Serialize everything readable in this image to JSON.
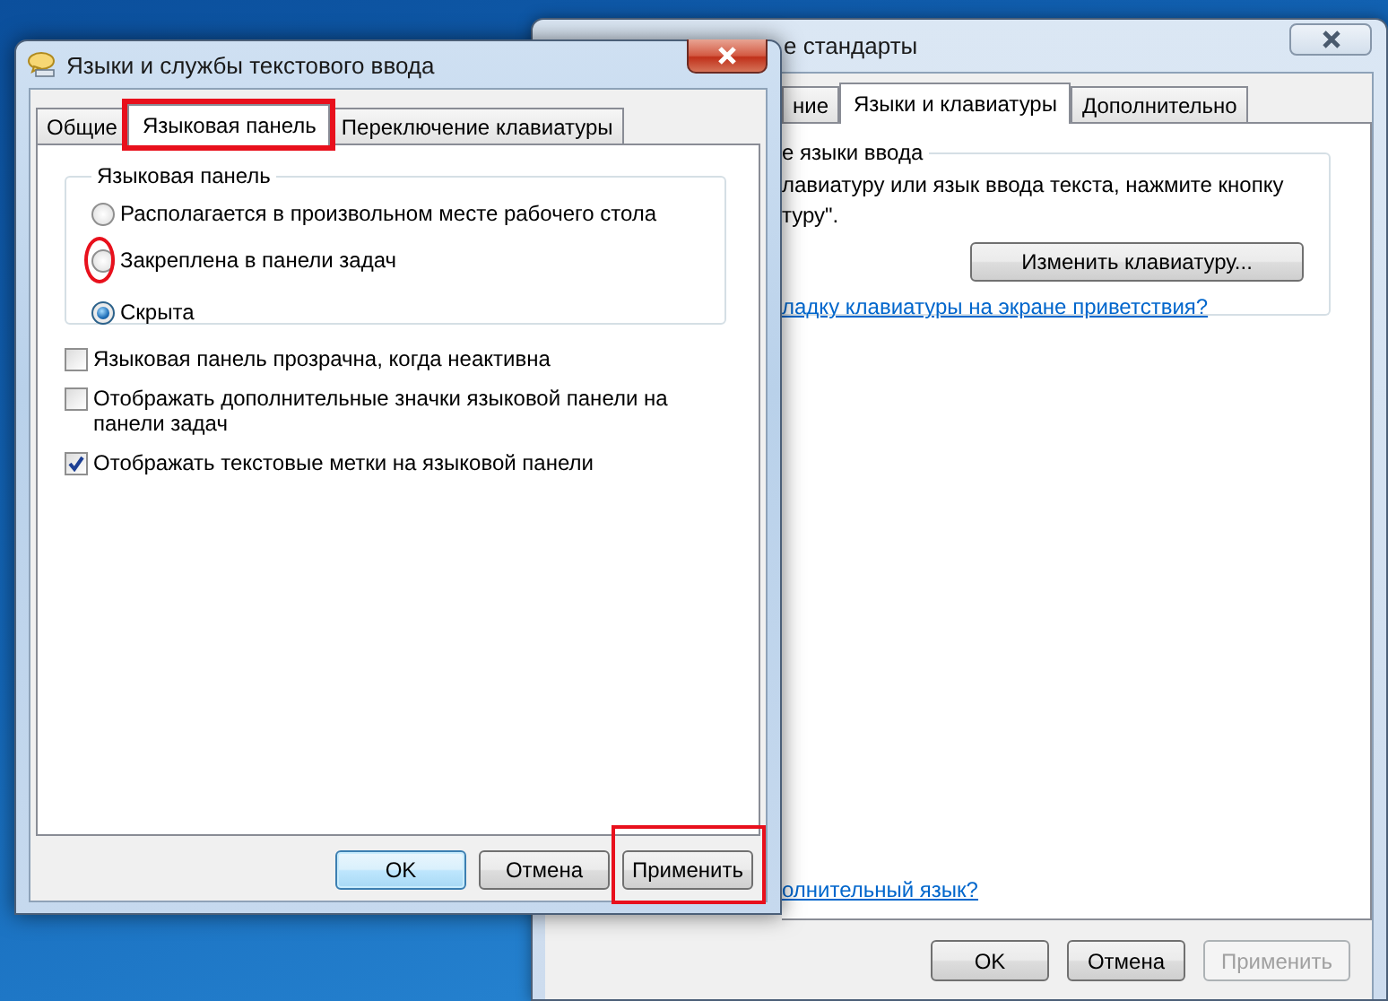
{
  "back_window": {
    "title": "е стандарты",
    "tabs": [
      {
        "label": "ние",
        "selected": false
      },
      {
        "label": "Языки и клавиатуры",
        "selected": true
      },
      {
        "label": "Дополнительно",
        "selected": false
      }
    ],
    "group": {
      "label": "е языки ввода",
      "text_lines": [
        "лавиатуру или язык ввода текста, нажмите кнопку",
        "туру\"."
      ],
      "button": "Изменить клавиатуру...",
      "link": "ладку клавиатуры на экране приветствия?"
    },
    "bottom_link": "олнительный язык?",
    "buttons": [
      {
        "label": "OK",
        "disabled": false
      },
      {
        "label": "Отмена",
        "disabled": false
      },
      {
        "label": "Применить",
        "disabled": true
      }
    ]
  },
  "front_window": {
    "title": "Языки и службы текстового ввода",
    "tabs": [
      {
        "label": "Общие",
        "selected": false,
        "highlighted": false
      },
      {
        "label": "Языковая панель",
        "selected": true,
        "highlighted": true
      },
      {
        "label": "Переключение клавиатуры",
        "selected": false,
        "highlighted": false
      }
    ],
    "group": {
      "label": "Языковая панель",
      "options": [
        {
          "label": "Располагается в произвольном месте рабочего стола",
          "selected": false,
          "highlighted": false
        },
        {
          "label": "Закреплена в панели задач",
          "selected": false,
          "highlighted": true
        },
        {
          "label": "Скрыта",
          "selected": true,
          "highlighted": false
        }
      ]
    },
    "checkboxes": [
      {
        "label": "Языковая панель прозрачна, когда неактивна",
        "checked": false
      },
      {
        "label": "Отображать дополнительные значки языковой панели на панели задач",
        "checked": false
      },
      {
        "label": "Отображать текстовые метки на языковой панели",
        "checked": true
      }
    ],
    "buttons": [
      {
        "label": "OK",
        "default": true,
        "disabled": false,
        "highlighted": false
      },
      {
        "label": "Отмена",
        "default": false,
        "disabled": false,
        "highlighted": false
      },
      {
        "label": "Применить",
        "default": false,
        "disabled": false,
        "highlighted": true
      }
    ]
  }
}
